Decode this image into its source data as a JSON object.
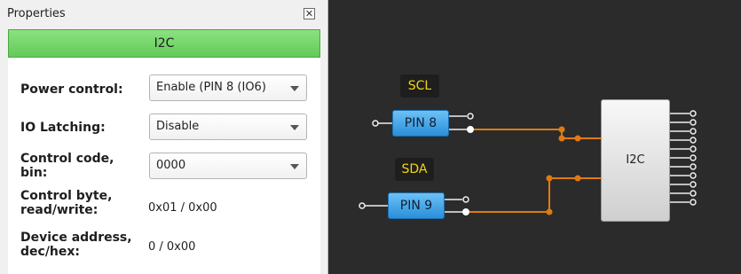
{
  "panel": {
    "title": "Properties",
    "close_glyph": "✕",
    "block_name": "I2C",
    "fields": [
      {
        "label": "Power control:",
        "value": "Enable (PIN 8 (IO6)",
        "type": "select"
      },
      {
        "label": "IO Latching:",
        "value": "Disable",
        "type": "select"
      },
      {
        "label": "Control code, bin:",
        "value": "0000",
        "type": "select"
      },
      {
        "label": "Control byte, read/write:",
        "value": "0x01 / 0x00",
        "type": "text"
      },
      {
        "label": "Device address, dec/hex:",
        "value": "0 / 0x00",
        "type": "text"
      }
    ]
  },
  "canvas": {
    "scl_label": "SCL",
    "sda_label": "SDA",
    "pin_scl": "PIN 8",
    "pin_sda": "PIN 9",
    "block_label": "I2C",
    "colors": {
      "wire": "#e07a10",
      "pin": "#2a8fd9",
      "tag_text": "#f5d514",
      "header": "#63c95a"
    }
  }
}
